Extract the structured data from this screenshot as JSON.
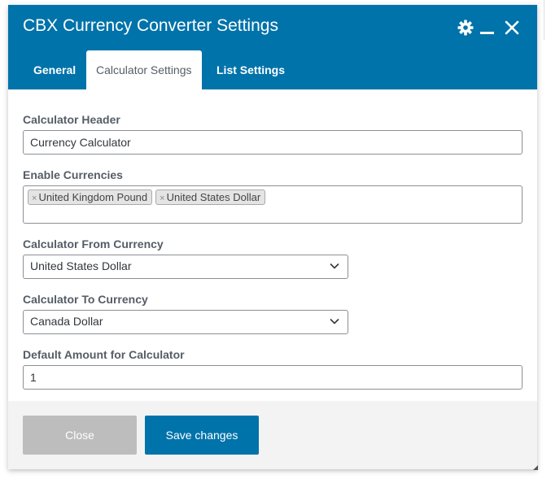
{
  "dialog": {
    "title": "CBX Currency Converter Settings",
    "icons": {
      "settings": "gear-icon",
      "minimize": "minimize-icon",
      "close": "close-icon"
    },
    "accent_color": "#0073aa"
  },
  "tabs": [
    {
      "label": "General",
      "active": false
    },
    {
      "label": "Calculator Settings",
      "active": true
    },
    {
      "label": "List Settings",
      "active": false
    }
  ],
  "form": {
    "calculator_header": {
      "label": "Calculator Header",
      "value": "Currency Calculator"
    },
    "enable_currencies": {
      "label": "Enable Currencies",
      "selected": [
        "United Kingdom Pound",
        "United States Dollar"
      ],
      "remove_symbol": "×"
    },
    "from_currency": {
      "label": "Calculator From Currency",
      "value": "United States Dollar"
    },
    "to_currency": {
      "label": "Calculator To Currency",
      "value": "Canada Dollar"
    },
    "default_amount": {
      "label": "Default Amount for Calculator",
      "value": "1"
    }
  },
  "footer": {
    "close_label": "Close",
    "save_label": "Save changes"
  }
}
